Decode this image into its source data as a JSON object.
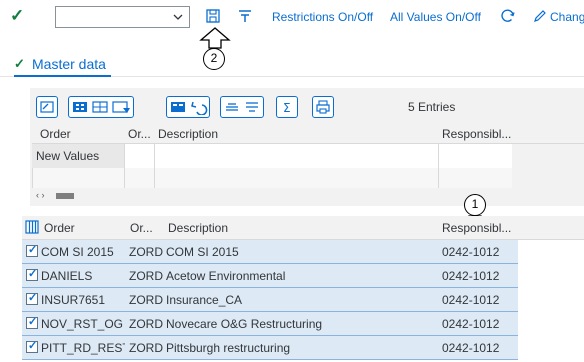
{
  "toolbar": {
    "confirm_icon": "check-icon",
    "combo_value": "",
    "save_icon": "save-icon",
    "filter_icon": "filter-icon",
    "restrictions_label": "Restrictions On/Off",
    "all_values_label": "All Values On/Off",
    "refresh_icon": "refresh-icon",
    "change_label": "Chang",
    "accent_color": "#0a6ed1"
  },
  "callouts": [
    {
      "number": "1"
    },
    {
      "number": "2"
    }
  ],
  "tab": {
    "label": "Master data",
    "status_icon": "check-icon"
  },
  "grid": {
    "entries_label": "5 Entries",
    "buttons": [
      "details-icon",
      "select-all-icon",
      "deselect-all-icon",
      "filter-icon",
      "insert-row-icon",
      "undo-icon",
      "align-icon",
      "list-icon",
      "sum-icon",
      "print-icon"
    ],
    "columns": [
      "Order",
      "Or...",
      "Description",
      "Responsibl..."
    ],
    "new_values_label": "New Values",
    "scroll_label": "‹ ›"
  },
  "results": {
    "columns": [
      "Order",
      "Or...",
      "Description",
      "Responsibl..."
    ],
    "rows": [
      {
        "order": "COM SI 2015",
        "type": "ZORD",
        "description": "COM SI 2015",
        "responsible": "0242-1012",
        "checked": true
      },
      {
        "order": "DANIELS",
        "type": "ZORD",
        "description": "Acetow Environmental",
        "responsible": "0242-1012",
        "checked": true
      },
      {
        "order": "INSUR7651",
        "type": "ZORD",
        "description": "Insurance_CA",
        "responsible": "0242-1012",
        "checked": true
      },
      {
        "order": "NOV_RST_OG",
        "type": "ZORD",
        "description": "Novecare O&G Restructuring",
        "responsible": "0242-1012",
        "checked": true
      },
      {
        "order": "PITT_RD_REST",
        "type": "ZORD",
        "description": "Pittsburgh restructuring",
        "responsible": "0242-1012",
        "checked": true
      }
    ],
    "row_color": "#dde9f5"
  }
}
